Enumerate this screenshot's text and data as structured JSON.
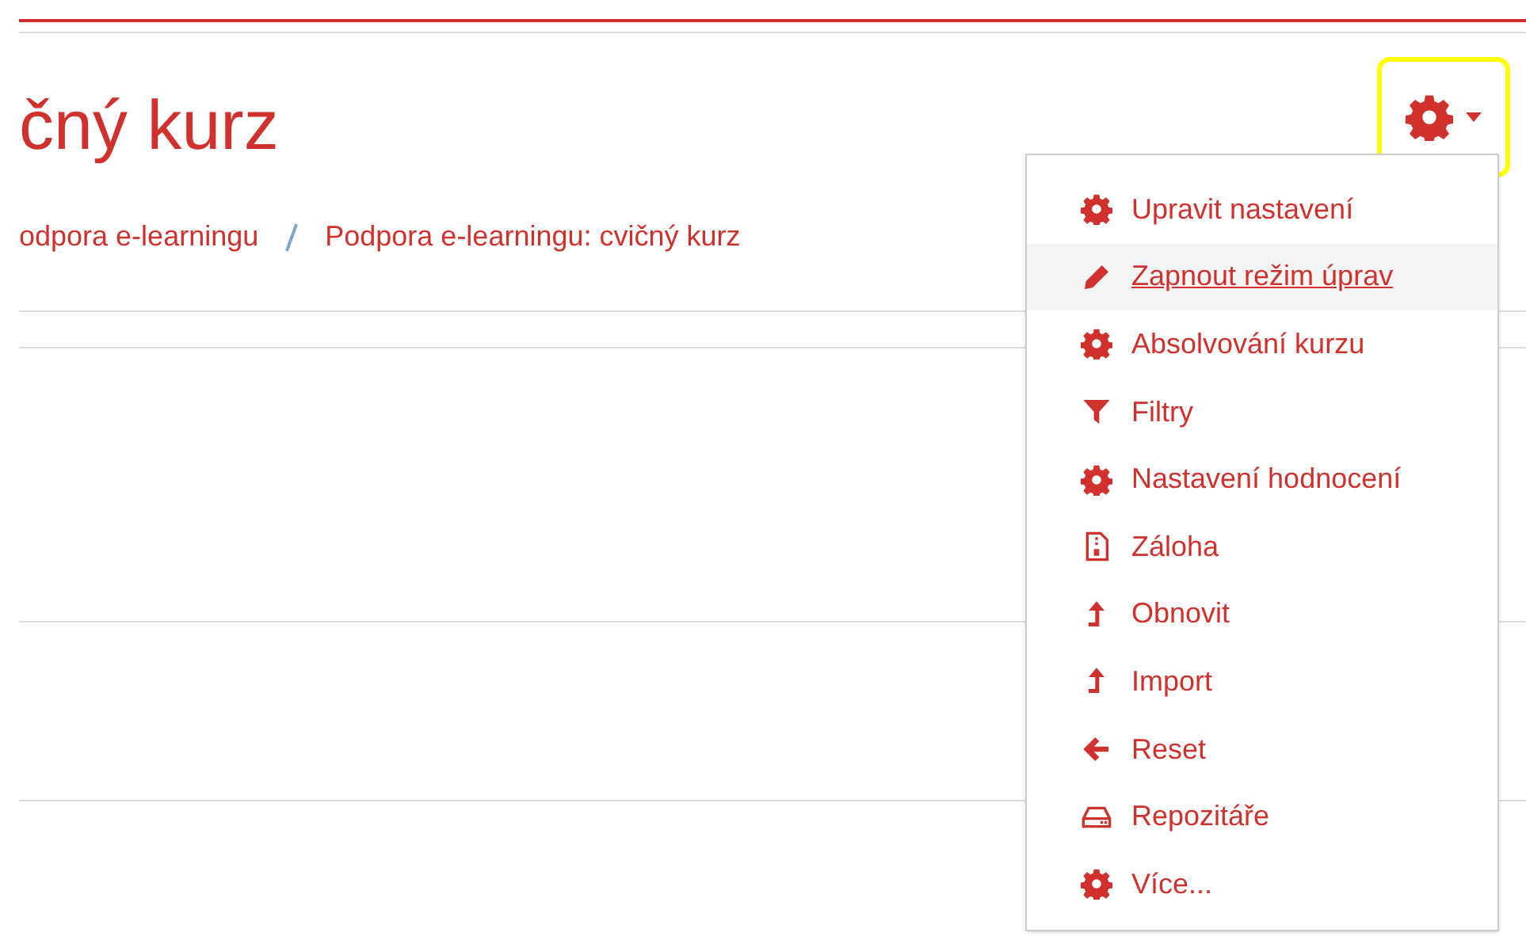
{
  "page_title": "čný kurz",
  "breadcrumb": [
    "odpora e-learningu",
    "Podpora e-learningu: cvičný kurz"
  ],
  "settings_button": {
    "highlighted": true
  },
  "menu": [
    {
      "label": "Upravit nastavení",
      "kind": "gear",
      "selected": false
    },
    {
      "label": "Zapnout režim úprav",
      "kind": "pencil",
      "selected": true
    },
    {
      "label": "Absolvování kurzu",
      "kind": "gear",
      "selected": false
    },
    {
      "label": "Filtry",
      "kind": "filter",
      "selected": false
    },
    {
      "label": "Nastavení hodnocení",
      "kind": "gear",
      "selected": false
    },
    {
      "label": "Záloha",
      "kind": "archive",
      "selected": false
    },
    {
      "label": "Obnovit",
      "kind": "upload",
      "selected": false
    },
    {
      "label": "Import",
      "kind": "upload",
      "selected": false
    },
    {
      "label": "Reset",
      "kind": "back",
      "selected": false
    },
    {
      "label": "Repozitáře",
      "kind": "drive",
      "selected": false
    },
    {
      "label": "Více...",
      "kind": "gear",
      "selected": false
    }
  ]
}
